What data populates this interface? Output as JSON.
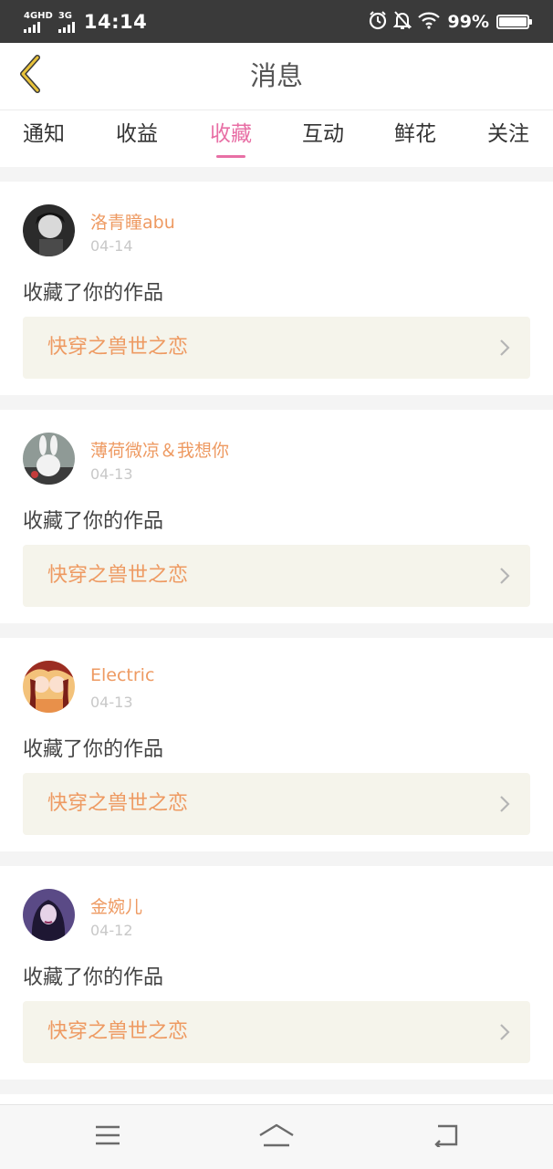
{
  "status_bar": {
    "network_primary": "4GHD",
    "network_secondary": "3G",
    "time": "14:14",
    "battery_text": "99%",
    "battery_level": 0.99,
    "icons": [
      "alarm-icon",
      "bell-off-icon",
      "wifi-icon",
      "battery-icon"
    ]
  },
  "header": {
    "title": "消息",
    "back_icon": "chevron-left-icon"
  },
  "tabs": [
    {
      "label": "通知",
      "active": false
    },
    {
      "label": "收益",
      "active": false
    },
    {
      "label": "收藏",
      "active": true
    },
    {
      "label": "互动",
      "active": false
    },
    {
      "label": "鲜花",
      "active": false
    },
    {
      "label": "关注",
      "active": false
    }
  ],
  "messages": [
    {
      "user": "洛青瞳abu",
      "date": "04-14",
      "action": "收藏了你的作品",
      "work_title": "快穿之兽世之恋"
    },
    {
      "user": "薄荷微凉＆我想你",
      "date": "04-13",
      "action": "收藏了你的作品",
      "work_title": "快穿之兽世之恋"
    },
    {
      "user": "Electric",
      "date": "04-13",
      "action": "收藏了你的作品",
      "work_title": "快穿之兽世之恋"
    },
    {
      "user": "金婉儿",
      "date": "04-12",
      "action": "收藏了你的作品",
      "work_title": "快穿之兽世之恋"
    }
  ],
  "bottom_nav": {
    "icons": [
      "menu-icon",
      "home-icon",
      "back-icon"
    ]
  },
  "colors": {
    "accent_pink": "#e86fa5",
    "username_orange": "#ee9a62",
    "work_bg": "#f5f4eb",
    "back_arrow": "#e8c23a"
  }
}
